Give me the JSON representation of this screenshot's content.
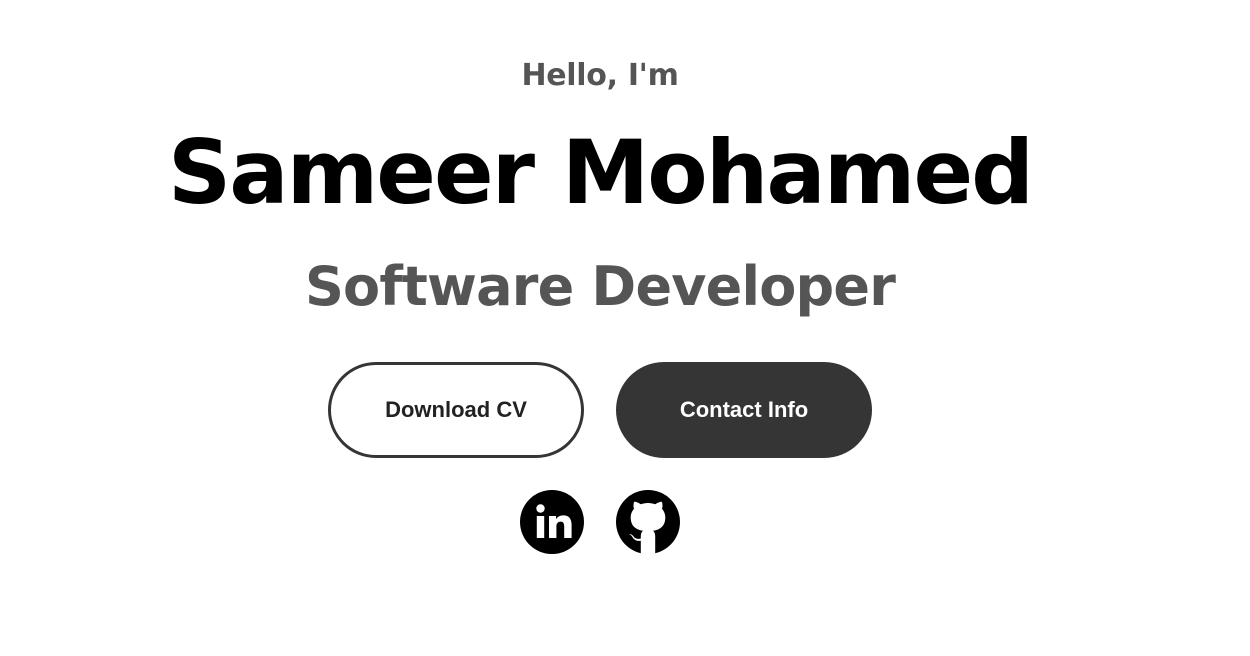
{
  "hero": {
    "greeting": "Hello, I'm",
    "name": "Sameer Mohamed",
    "role": "Software Developer"
  },
  "buttons": {
    "download_cv_label": "Download CV",
    "contact_info_label": "Contact Info"
  },
  "social": {
    "icons": [
      "linkedin-icon",
      "github-icon"
    ]
  },
  "colors": {
    "background": "#ffffff",
    "name_text": "#000000",
    "muted_text": "#555555",
    "button_dark": "#353535"
  }
}
